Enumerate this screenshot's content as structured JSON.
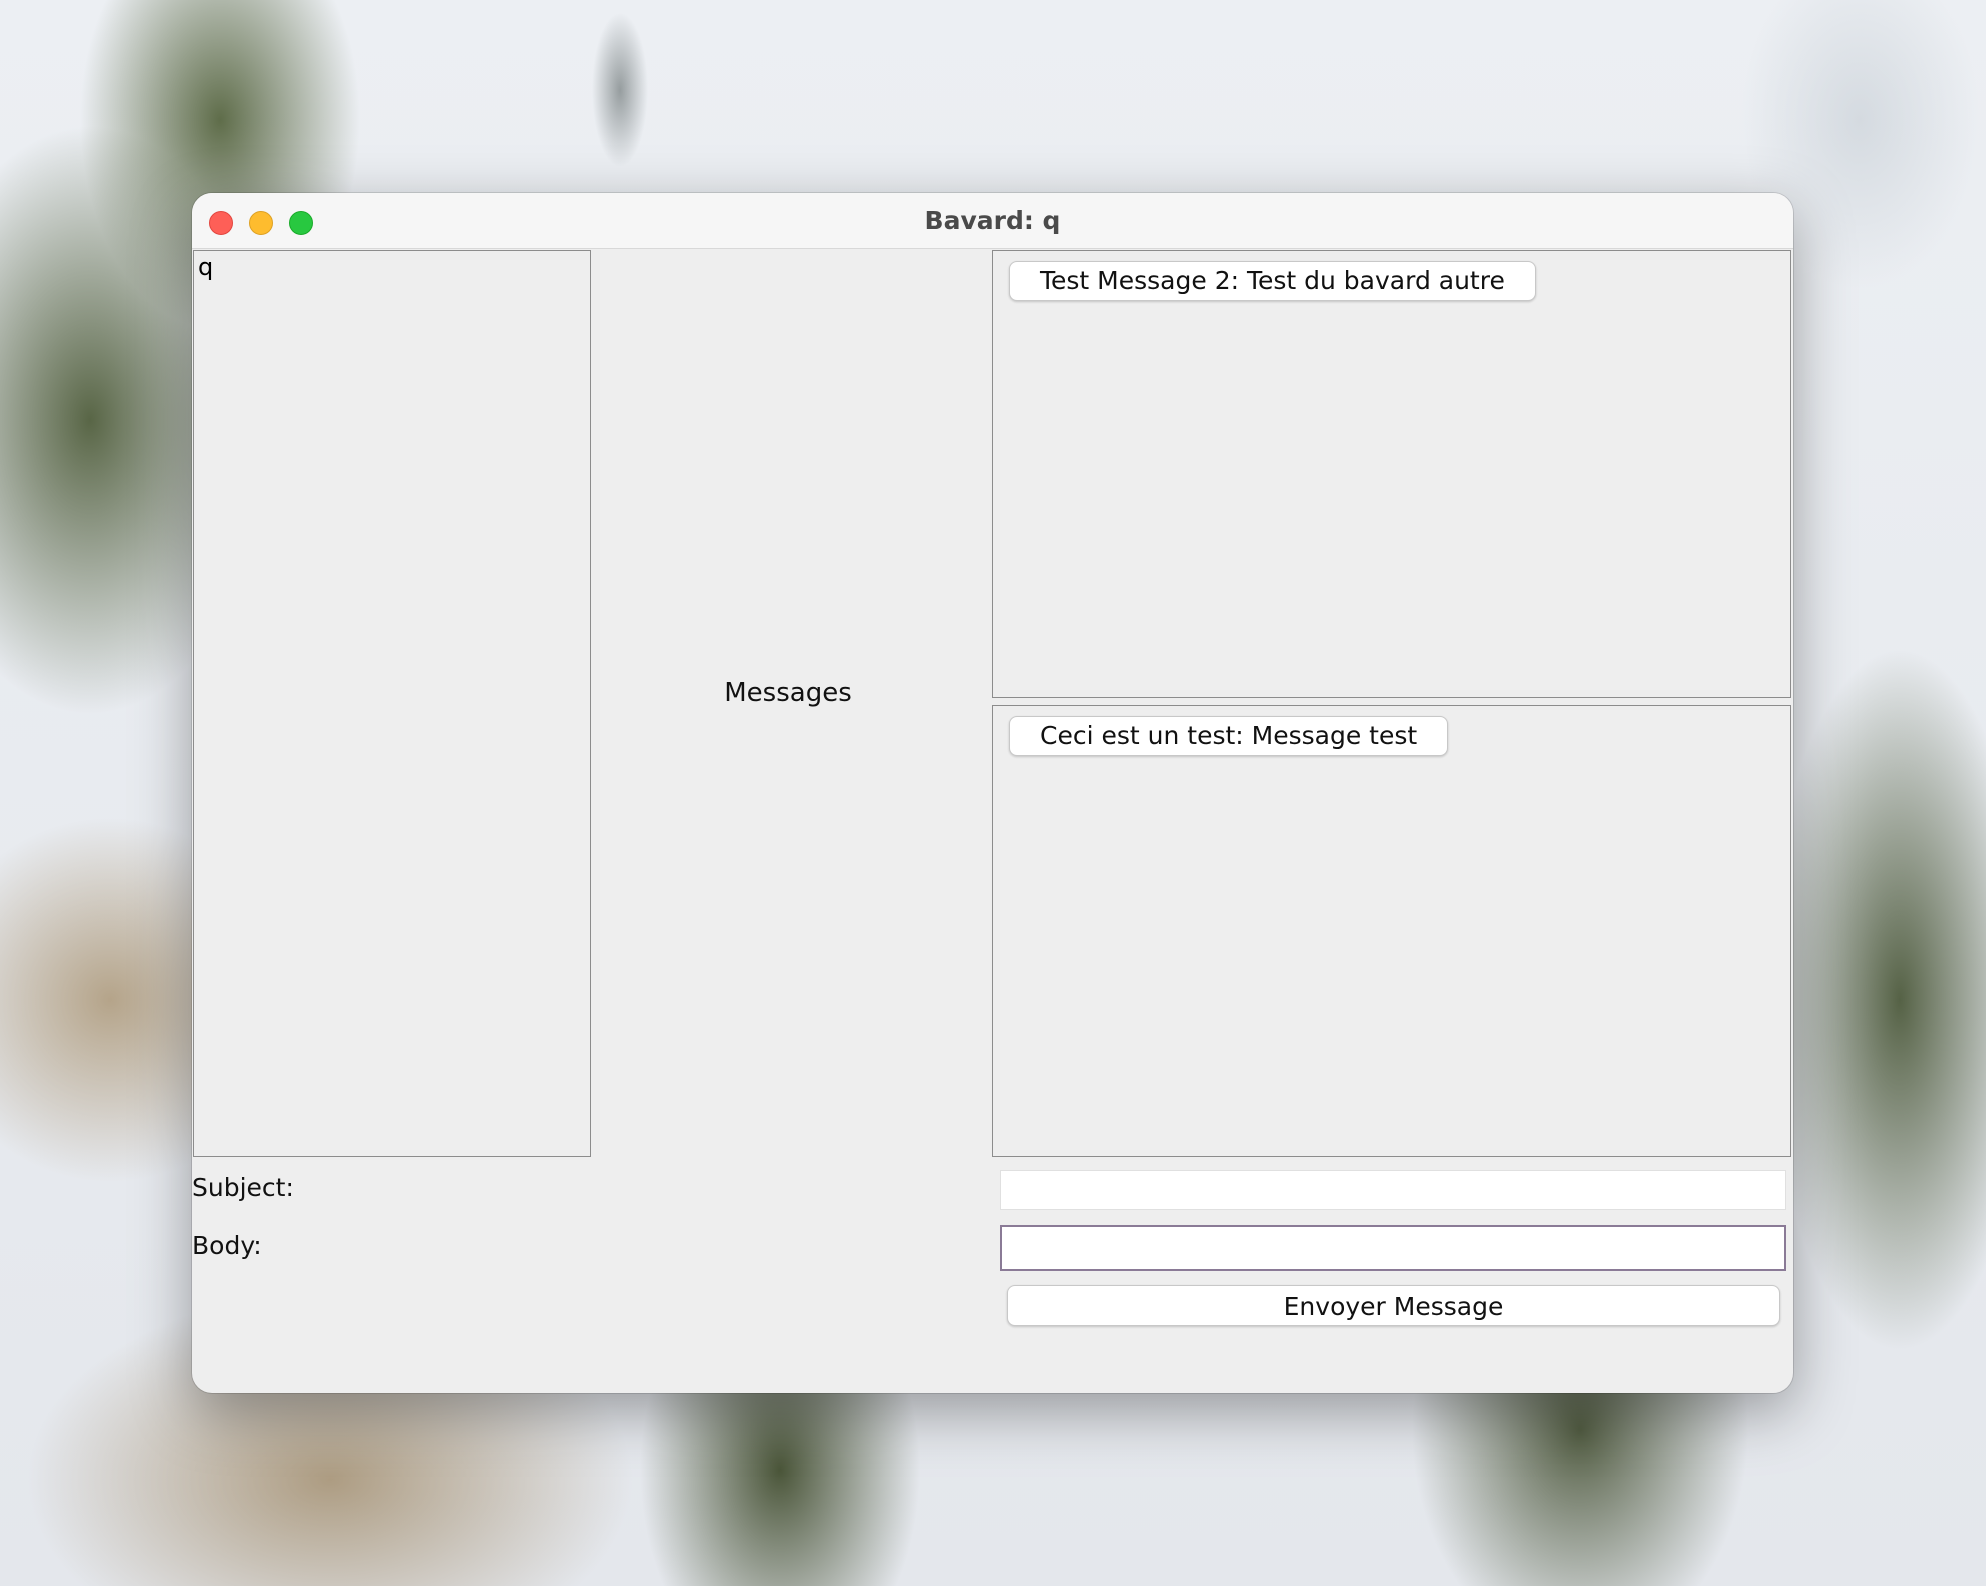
{
  "window": {
    "title": "Bavard: q",
    "controls": [
      "close",
      "minimize",
      "zoom"
    ]
  },
  "users": {
    "items": [
      "q"
    ]
  },
  "messages_label": "Messages",
  "message_panels": [
    {
      "button_label": "Test Message 2: Test du bavard autre"
    },
    {
      "button_label": "Ceci est un test: Message test"
    }
  ],
  "form": {
    "subject_label": "Subject:",
    "subject_value": "",
    "body_label": "Body:",
    "body_value": "",
    "send_label": "Envoyer Message"
  },
  "colors": {
    "window_background": "#eeeeee",
    "close": "#fe5f57",
    "minimize": "#febc2e",
    "zoom": "#28c840",
    "focus_border": "#8a7a96"
  }
}
